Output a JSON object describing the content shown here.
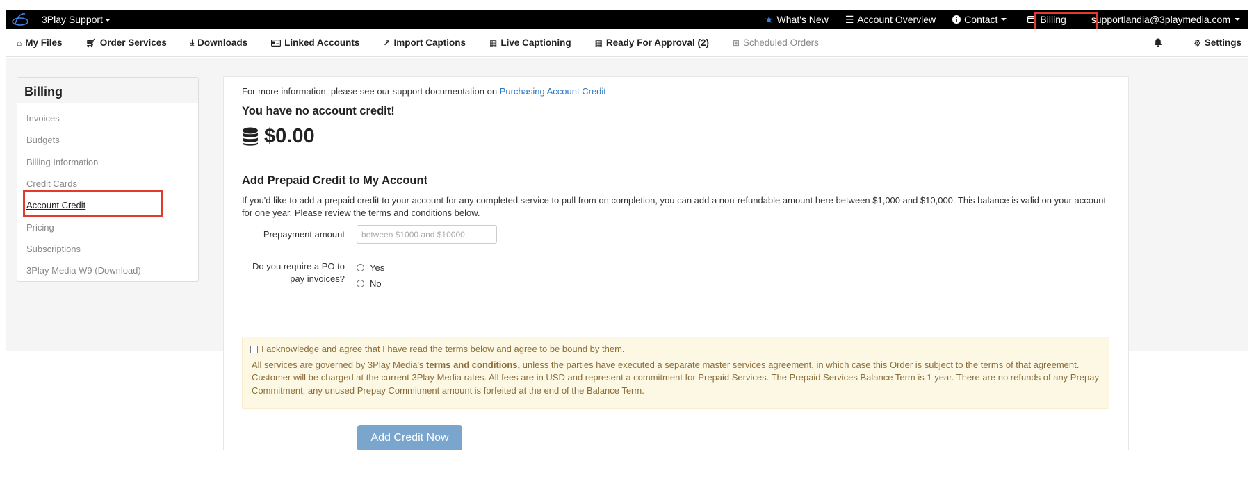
{
  "topbar": {
    "brand": "3Play Support",
    "items": [
      {
        "label": "What's New",
        "icon": "star-icon"
      },
      {
        "label": "Account Overview",
        "icon": "list-icon"
      },
      {
        "label": "Contact",
        "icon": "info-icon"
      },
      {
        "label": "Billing",
        "icon": "credit-card-icon"
      },
      {
        "label": "supportlandia@3playmedia.com",
        "icon": ""
      }
    ],
    "highlight_color": "#e13b2a"
  },
  "nav": {
    "items": [
      {
        "label": "My Files",
        "icon": "home-icon"
      },
      {
        "label": "Order Services",
        "icon": "cart-icon"
      },
      {
        "label": "Downloads",
        "icon": "download-icon"
      },
      {
        "label": "Linked Accounts",
        "icon": "id-card-icon"
      },
      {
        "label": "Import Captions",
        "icon": "share-icon"
      },
      {
        "label": "Live Captioning",
        "icon": "calendar-icon"
      },
      {
        "label": "Ready For Approval (2)",
        "icon": "calendar-icon"
      },
      {
        "label": "Scheduled Orders",
        "icon": "calendar-plus-icon"
      }
    ],
    "settings": "Settings"
  },
  "sidebar": {
    "title": "Billing",
    "items": [
      "Invoices",
      "Budgets",
      "Billing Information",
      "Credit Cards",
      "Account Credit",
      "Pricing",
      "Subscriptions",
      "3Play Media W9 (Download)"
    ],
    "active": "Account Credit"
  },
  "main": {
    "info_prefix": "For more information, please see our support documentation on ",
    "info_link": "Purchasing Account Credit",
    "no_credit": "You have no account credit!",
    "balance": "$0.00",
    "add_heading": "Add Prepaid Credit to My Account",
    "description": "If you'd like to add a prepaid credit to your account for any completed service to pull from on completion, you can add a non-refundable amount here between $1,000 and $10,000. This balance is valid on your account for one year. Please review the terms and conditions below.",
    "prepay_label": "Prepayment amount",
    "prepay_placeholder": "between $1000 and $10000",
    "po_label": "Do you require a PO to pay invoices?",
    "po_yes": "Yes",
    "po_no": "No",
    "ack_text": "I acknowledge and agree that I have read the terms below and agree to be bound by them.",
    "terms_prefix": "All services are governed by 3Play Media's ",
    "terms_link": "terms and conditions,",
    "terms_rest": " unless the parties have executed a separate master services agreement, in which case this Order is subject to the terms of that agreement. Customer will be charged at the current 3Play Media rates. All fees are in USD and represent a commitment for Prepaid Services. The Prepaid Services Balance Term is 1 year. There are no refunds of any Prepay Commitment; any unused Prepay Commitment amount is forfeited at the end of the Balance Term.",
    "button": "Add Credit Now"
  }
}
